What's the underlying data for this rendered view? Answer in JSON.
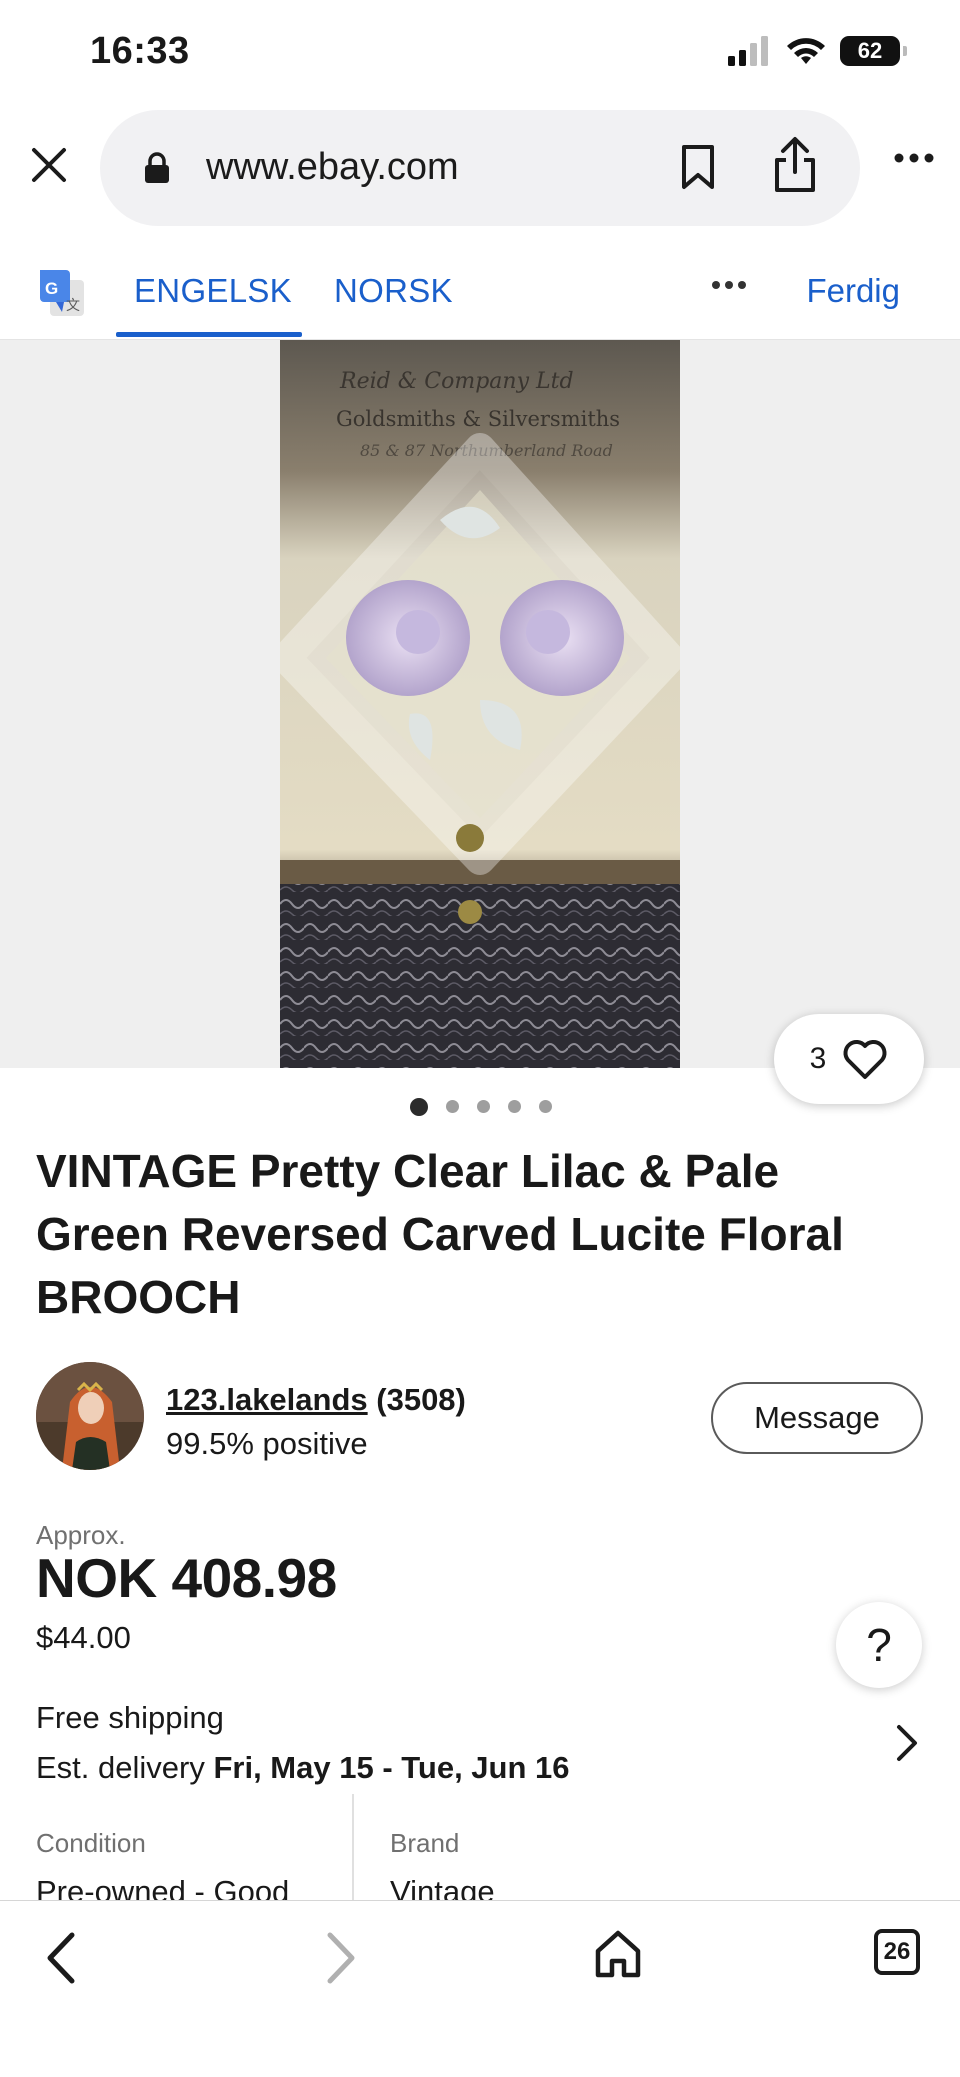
{
  "status_bar": {
    "time": "16:33",
    "battery": "62"
  },
  "browser": {
    "url": "www.ebay.com"
  },
  "translate_bar": {
    "tab_source": "ENGELSK",
    "tab_target": "NORSK",
    "done_label": "Ferdig"
  },
  "listing": {
    "like_count": "3",
    "image_count": 5,
    "active_image_index": 0,
    "title": "VINTAGE Pretty Clear Lilac & Pale Green Reversed Carved Lucite Floral BROOCH",
    "seller": {
      "name": "123.lakelands",
      "feedback_count": "(3508)",
      "positive": "99.5% positive",
      "message_label": "Message"
    },
    "price": {
      "approx_label": "Approx.",
      "local": "NOK 408.98",
      "usd": "$44.00"
    },
    "help_label": "?",
    "shipping": {
      "label": "Free shipping",
      "delivery_prefix": "Est. delivery",
      "delivery_dates": "Fri, May 15 - Tue, Jun 16"
    },
    "specs": {
      "condition_label": "Condition",
      "condition_value": "Pre-owned - Good",
      "brand_label": "Brand",
      "brand_value": "Vintage"
    }
  },
  "toolbar": {
    "tab_count": "26"
  },
  "icons": {
    "close": "close-icon",
    "lock": "lock-icon",
    "bookmark": "bookmark-icon",
    "share": "share-icon",
    "more": "more-icon",
    "translate": "google-translate-icon",
    "heart": "heart-icon",
    "chevron": "chevron-right-icon",
    "back": "back-icon",
    "forward": "forward-icon",
    "home": "home-icon"
  },
  "colors": {
    "accent": "#1a5fcb",
    "text": "#191919",
    "muted": "#707070",
    "hero_bg": "#efefef"
  }
}
